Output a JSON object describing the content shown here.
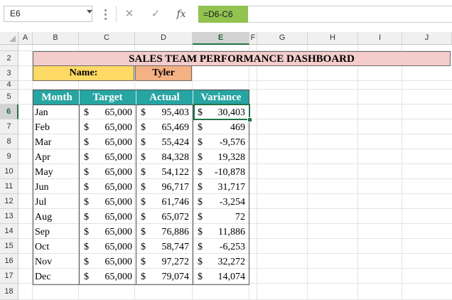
{
  "formula_bar": {
    "name_box": "E6",
    "cancel_glyph": "✕",
    "enter_glyph": "✓",
    "function_glyph": "fx",
    "formula": "=D6-C6"
  },
  "columns": [
    "A",
    "B",
    "C",
    "D",
    "E",
    "F",
    "G",
    "H",
    "I",
    "J"
  ],
  "selected_column": "E",
  "rows": [
    "2",
    "3",
    "4",
    "5",
    "6",
    "7",
    "8",
    "9",
    "10",
    "11",
    "12",
    "13",
    "14",
    "15",
    "16",
    "17",
    "18"
  ],
  "selected_row": "6",
  "dashboard": {
    "title": "SALES TEAM PERFORMANCE DASHBOARD",
    "name_label": "Name:",
    "name_value": "Tyler"
  },
  "table": {
    "headers": [
      "Month",
      "Target",
      "Actual",
      "Variance"
    ],
    "currency": "$",
    "rows": [
      {
        "month": "Jan",
        "target": "65,000",
        "actual": "95,403",
        "variance": "30,403"
      },
      {
        "month": "Feb",
        "target": "65,000",
        "actual": "65,469",
        "variance": "469"
      },
      {
        "month": "Mar",
        "target": "65,000",
        "actual": "55,424",
        "variance": "-9,576"
      },
      {
        "month": "Apr",
        "target": "65,000",
        "actual": "84,328",
        "variance": "19,328"
      },
      {
        "month": "May",
        "target": "65,000",
        "actual": "54,122",
        "variance": "-10,878"
      },
      {
        "month": "Jun",
        "target": "65,000",
        "actual": "96,717",
        "variance": "31,717"
      },
      {
        "month": "Jul",
        "target": "65,000",
        "actual": "61,746",
        "variance": "-3,254"
      },
      {
        "month": "Aug",
        "target": "65,000",
        "actual": "65,072",
        "variance": "72"
      },
      {
        "month": "Sep",
        "target": "65,000",
        "actual": "76,886",
        "variance": "11,886"
      },
      {
        "month": "Oct",
        "target": "65,000",
        "actual": "58,747",
        "variance": "-6,253"
      },
      {
        "month": "Nov",
        "target": "65,000",
        "actual": "97,272",
        "variance": "32,272"
      },
      {
        "month": "Dec",
        "target": "65,000",
        "actual": "79,074",
        "variance": "14,074"
      }
    ]
  },
  "colors": {
    "title_fill": "#f4cccc",
    "name_label_fill": "#ffd966",
    "name_value_fill": "#f4b183",
    "header_fill": "#26a5a2",
    "formula_fill": "#92c250",
    "selection": "#217346"
  }
}
